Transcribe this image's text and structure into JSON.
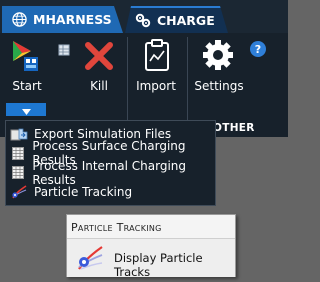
{
  "tabs": [
    {
      "label": "MHARNESS",
      "icon": "globe-icon"
    },
    {
      "label": "CHARGE",
      "icon": "charge-gears-icon"
    }
  ],
  "ribbon": {
    "buttons": [
      {
        "label": "Start",
        "icon": "start-app-icon"
      },
      {
        "label": "Kill",
        "icon": "kill-x-icon"
      },
      {
        "label": "Import",
        "icon": "import-clipboard-icon"
      },
      {
        "label": "Settings",
        "icon": "gear-icon"
      }
    ],
    "groups": [
      "OTHER"
    ],
    "help": "?"
  },
  "menu": {
    "items": [
      {
        "label": "Export Simulation Files",
        "icon": "export-files-icon"
      },
      {
        "label": "Process Surface Charging Results",
        "icon": "table-grid-icon"
      },
      {
        "label": "Process Internal Charging Results",
        "icon": "table-grid-icon"
      },
      {
        "label": "Particle Tracking",
        "icon": "particle-tracking-icon"
      }
    ]
  },
  "tooltip": {
    "title": "Particle Tracking",
    "body": "Display Particle Tracks",
    "icon": "particle-tracks-icon"
  },
  "colors": {
    "tab_active": "#1f69b4",
    "ribbon_bg": "#17212b",
    "accent": "#1e78d2"
  }
}
